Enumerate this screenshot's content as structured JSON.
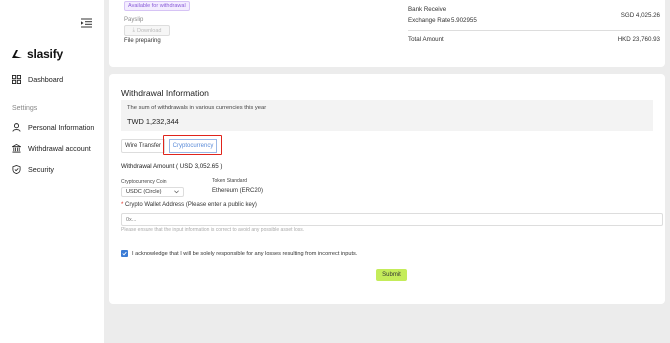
{
  "app": {
    "brand": "slasify"
  },
  "sidebar": {
    "dashboard": "Dashboard",
    "settings_label": "Settings",
    "items": [
      {
        "label": "Personal Information"
      },
      {
        "label": "Withdrawal account"
      },
      {
        "label": "Security"
      }
    ]
  },
  "summary_card": {
    "available_badge": "Available for withdrawal",
    "payslip_label": "Payslip",
    "download_label": "Download",
    "file_status": "File preparing",
    "bank_receive_label": "Bank Receive",
    "bank_receive_value": "SGD 4,025.26",
    "exchange_rate_label": "Exchange Rate",
    "exchange_rate_value": "5.902955",
    "total_amount_label": "Total Amount",
    "total_amount_value": "HKD 23,760.93"
  },
  "withdrawal": {
    "title": "Withdrawal Information",
    "sum_description": "The sum of withdrawals in various currencies this year",
    "sum_value": "TWD 1,232,344",
    "tabs": [
      "Wire Transfer",
      "Cryptocurrency"
    ],
    "amount_label": "Withdrawal Amount ( USD 3,052.65 )",
    "coin_label": "Cryptocurrency Coin",
    "coin_value": "USDC (Circle)",
    "token_label": "Token Standard",
    "token_value": "Ethereum (ERC20)",
    "wallet_required_mark": "*",
    "wallet_label": "Crypto Wallet Address (Please enter a public key)",
    "wallet_placeholder": "0x...",
    "hint": "Please ensure that the input information is correct to avoid any possible asset loss.",
    "ack_text": "I acknowledge that I will be solely responsible for any losses resulting from incorrect inputs.",
    "submit_label": "Submit"
  },
  "colors": {
    "accent": "#c4ec5a",
    "highlight": "#e0241b",
    "link": "#5a8bd8"
  }
}
